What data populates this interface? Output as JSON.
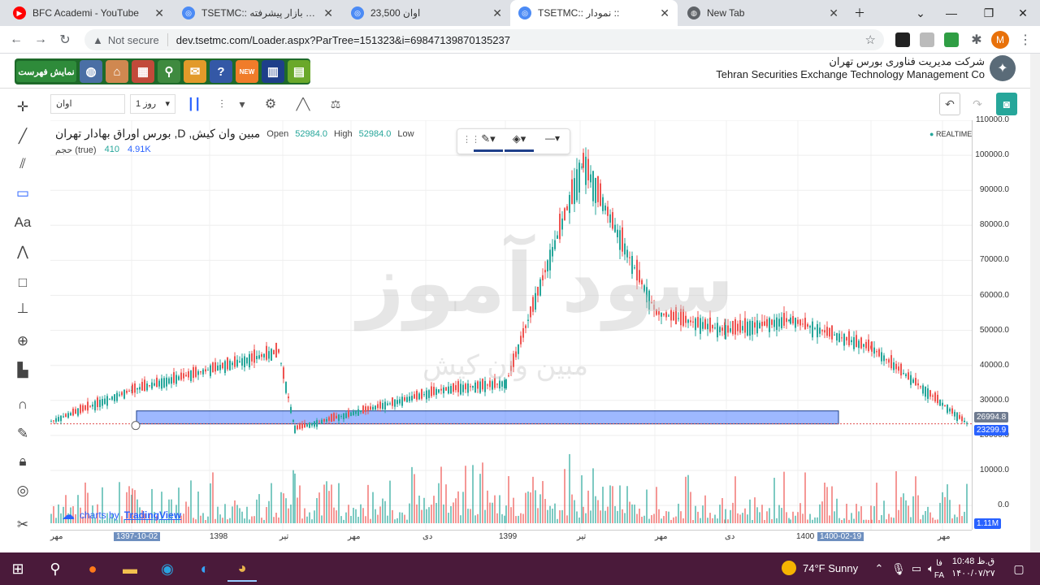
{
  "browser": {
    "tabs": [
      {
        "title": "BFC Academi - YouTube",
        "favicon": "youtube-icon",
        "active": false
      },
      {
        "title": "TSETMC:: ه بان بازار پیشرفته :: ",
        "favicon": "chrome-generic-icon",
        "active": false
      },
      {
        "title": "اوان 23,500",
        "favicon": "chrome-generic-icon",
        "active": false
      },
      {
        "title": "TSETMC:: نمودار :: ",
        "favicon": "chrome-generic-icon",
        "active": true
      },
      {
        "title": "New Tab",
        "favicon": "globe-icon",
        "active": false
      }
    ],
    "address": {
      "security": "Not secure",
      "url": "dev.tsetmc.com/Loader.aspx?ParTree=151323&i=69847139870135237"
    },
    "profile_initial": "M"
  },
  "site": {
    "show_list": "نمایش فهرست",
    "company_fa": "شرکت مدیریت فناوری بورس تهران",
    "company_en": "Tehran Securities Exchange Technology Management Co"
  },
  "chart_toolbar": {
    "symbol": "اوان",
    "interval": "1 روز"
  },
  "legend": {
    "title": "بورس اوراق بهادار تهران ,D ,مبین وان کیش",
    "open_label": "Open",
    "open": "52984.0",
    "high_label": "High",
    "high": "52984.0",
    "low_label": "Low",
    "volume_label": "حجم (true)",
    "volume_value": "410",
    "volume_ma": "4.91K"
  },
  "realtime": "REALTIME",
  "watermark": {
    "main": "سود آموز",
    "sub": "مبین وان کیش"
  },
  "attribution": {
    "prefix": "charts by",
    "brand": "TradingView"
  },
  "price_axis": [
    "110000.0",
    "100000.0",
    "90000.0",
    "80000.0",
    "70000.0",
    "60000.0",
    "50000.0",
    "40000.0",
    "30000.0",
    "20000.0",
    "10000.0",
    "0.0"
  ],
  "price_tags": {
    "upper": "26994.8",
    "lower": "23299.9",
    "volume": "1.11M"
  },
  "time_axis": [
    "مهر",
    "1397-10-02",
    "1398",
    "تیر",
    "مهر",
    "دی",
    "1399",
    "تیر",
    "مهر",
    "دی",
    "1400",
    "1400-02-19",
    "مهر"
  ],
  "taskbar": {
    "weather": "74°F  Sunny",
    "time": "10:48 ق.ظ",
    "date": "۱۴۰۰/۰۷/۲۷",
    "lang1": "فا",
    "lang2": "FA"
  },
  "chart_data": {
    "type": "candlestick",
    "title": "بورس اوراق بهادار تهران ,D ,مبین وان کیش",
    "ylim": [
      0,
      110000
    ],
    "x": [
      "1397-10",
      "1398-01",
      "1398-04",
      "1398-07",
      "1398-10",
      "1399-01",
      "1399-04",
      "1399-07",
      "1399-10",
      "1400-01",
      "1400-04",
      "1400-07"
    ],
    "close": [
      24000,
      33000,
      44000,
      22000,
      33000,
      35000,
      98000,
      55000,
      50000,
      53000,
      45000,
      23300
    ],
    "highlight_band": [
      23300,
      27000
    ],
    "series": [
      {
        "name": "حجم",
        "type": "volume"
      }
    ]
  }
}
